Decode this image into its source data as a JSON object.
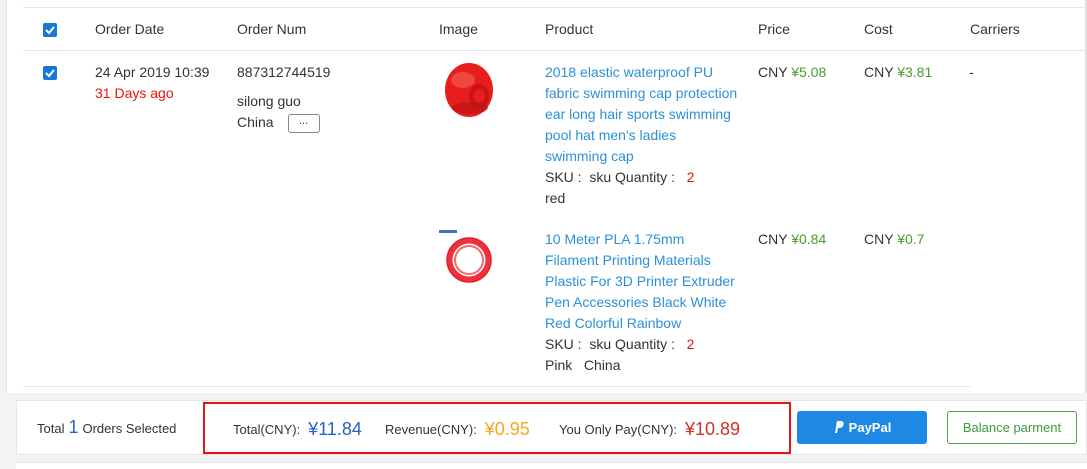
{
  "table": {
    "headers": {
      "order_date": "Order Date",
      "order_num": "Order Num",
      "image": "Image",
      "product": "Product",
      "price": "Price",
      "cost": "Cost",
      "carriers": "Carriers"
    },
    "order": {
      "date": "24 Apr 2019 10:39",
      "age": "31 Days ago",
      "number": "887312744519",
      "customer": "silong guo",
      "country": "China",
      "more_label": "...",
      "carrier": "-",
      "items": [
        {
          "image_icon": "red-swim-cap-image",
          "title_lines": [
            "2018 elastic waterproof PU",
            "fabric swimming cap protection",
            "ear long hair sports swimming",
            "pool hat men's ladies",
            "swimming cap"
          ],
          "sku_label": "SKU :",
          "sku_value": "sku",
          "qty_label": "Quantity :",
          "qty_value": "2",
          "variant": "red",
          "price_currency": "CNY",
          "price_value": "¥5.08",
          "cost_currency": "CNY",
          "cost_value": "¥3.81"
        },
        {
          "image_icon": "red-filament-coil-image",
          "title_lines": [
            "10 Meter PLA 1.75mm",
            "Filament Printing Materials",
            "Plastic For 3D Printer Extruder",
            "Pen Accessories Black White",
            "Red Colorful Rainbow"
          ],
          "sku_label": "SKU :",
          "sku_value": "sku",
          "qty_label": "Quantity :",
          "qty_value": "2",
          "variant": "Pink   China",
          "price_currency": "CNY",
          "price_value": "¥0.84",
          "cost_currency": "CNY",
          "cost_value": "¥0.7"
        }
      ]
    }
  },
  "footer": {
    "selected_prefix": "Total",
    "selected_count": "1",
    "selected_suffix": "Orders Selected",
    "total_label": "Total(CNY):",
    "total_value": "¥11.84",
    "revenue_label": "Revenue(CNY):",
    "revenue_value": "¥0.95",
    "pay_label": "You Only Pay(CNY):",
    "pay_value": "¥10.89",
    "paypal_label": "PayPal",
    "balance_label": "Balance parment"
  },
  "colors": {
    "accent_blue": "#1e88e5",
    "total_blue": "#2463c5",
    "revenue_orange": "#f5a623",
    "pay_red": "#d0312d",
    "price_green": "#4d9c2d",
    "highlight_red": "#e4141b"
  }
}
